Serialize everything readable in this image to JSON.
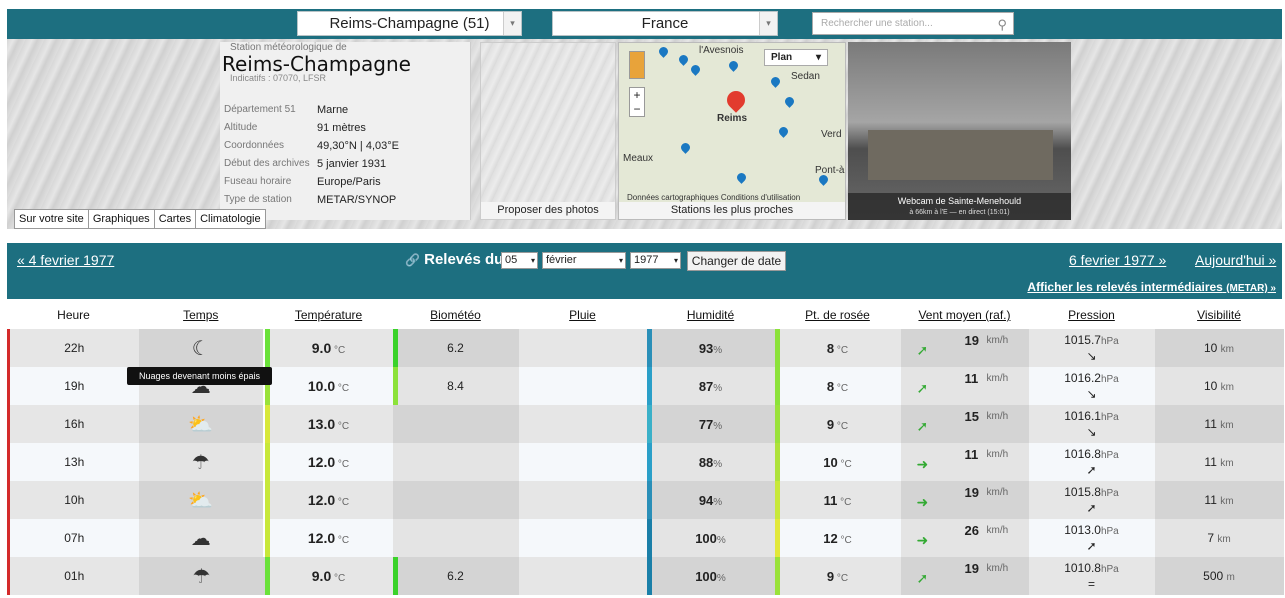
{
  "top": {
    "station_select": "Reims-Champagne (51)",
    "country_select": "France",
    "search_placeholder": "Rechercher une station..."
  },
  "station": {
    "kind": "Station météorologique de",
    "name": "Reims-Champagne",
    "indicatifs": "Indicatifs : 07070, LFSR",
    "rows": [
      {
        "k": "Département 51",
        "v": "Marne"
      },
      {
        "k": "Altitude",
        "v": "91 mètres"
      },
      {
        "k": "Coordonnées",
        "v": "49,30°N | 4,03°E"
      },
      {
        "k": "Début des archives",
        "v": "5 janvier 1931"
      },
      {
        "k": "Fuseau horaire",
        "v": "Europe/Paris"
      },
      {
        "k": "Type de station",
        "v": "METAR/SYNOP"
      }
    ]
  },
  "tabs": [
    "Sur votre site",
    "Graphiques",
    "Cartes",
    "Climatologie"
  ],
  "photos_label": "Proposer des photos",
  "map": {
    "label": "Stations les plus proches",
    "plan": "Plan",
    "attribution": "Données cartographiques   Conditions d'utilisation",
    "cities": [
      "l'Avesnois",
      "Sedan",
      "Reims",
      "Meaux",
      "Pont-à",
      "Verd"
    ]
  },
  "webcam": {
    "title": "Webcam de Sainte-Menehould",
    "sub": "à 66km à l'E — en direct (15:01)"
  },
  "datebar": {
    "prev": "« 4 fevrier 1977",
    "label": "Relevés du",
    "day": "05",
    "month": "février",
    "year": "1977",
    "change": "Changer de date",
    "next": "6 fevrier 1977 »",
    "today": "Aujourd'hui »",
    "intermediate": "Afficher les relevés intermédiaires",
    "intermediate_tag": "(METAR) »"
  },
  "columns": [
    "Heure",
    "Temps",
    "Température",
    "Biométéo",
    "Pluie",
    "Humidité",
    "Pt. de rosée",
    "Vent moyen (raf.)",
    "Pression",
    "Visibilité"
  ],
  "tooltip": "Nuages devenant moins épais",
  "rows": [
    {
      "hour": "22h",
      "icon": "clear-night-icon",
      "glyph": "☾",
      "temp": "9.0",
      "bio": "6.2",
      "hum": "93",
      "dew": "8",
      "wind": "19",
      "wind_dir": "➚",
      "press": "1015.7",
      "ptrend": "↘",
      "vis": "10",
      "vis_unit": "km",
      "tcolor": "#6ae23a",
      "bcolor": "#3ad22a",
      "hcolor": "#2a8fb8",
      "dcolor": "#8ce23a"
    },
    {
      "hour": "19h",
      "icon": "cloudy-icon",
      "glyph": "☁",
      "temp": "10.0",
      "bio": "8.4",
      "hum": "87",
      "dew": "8",
      "wind": "11",
      "wind_dir": "➚",
      "press": "1016.2",
      "ptrend": "↘",
      "vis": "10",
      "vis_unit": "km",
      "tcolor": "#9ae23a",
      "bcolor": "#8ce23a",
      "hcolor": "#2a9fc8",
      "dcolor": "#8ce23a"
    },
    {
      "hour": "16h",
      "icon": "partly-cloudy-icon",
      "glyph": "⛅",
      "temp": "13.0",
      "bio": "",
      "hum": "77",
      "dew": "9",
      "wind": "15",
      "wind_dir": "➚",
      "press": "1016.1",
      "ptrend": "↘",
      "vis": "11",
      "vis_unit": "km",
      "tcolor": "#d8e83a",
      "bcolor": "",
      "hcolor": "#3ab0c8",
      "dcolor": "#9ae23a"
    },
    {
      "hour": "13h",
      "icon": "rain-icon",
      "glyph": "☂",
      "temp": "12.0",
      "bio": "",
      "hum": "88",
      "dew": "10",
      "wind": "11",
      "wind_dir": "➜",
      "press": "1016.8",
      "ptrend": "➚",
      "vis": "11",
      "vis_unit": "km",
      "tcolor": "#c8e83a",
      "bcolor": "",
      "hcolor": "#2a9fc8",
      "dcolor": "#aee23a"
    },
    {
      "hour": "10h",
      "icon": "partly-cloudy-icon",
      "glyph": "⛅",
      "temp": "12.0",
      "bio": "",
      "hum": "94",
      "dew": "11",
      "wind": "19",
      "wind_dir": "➜",
      "press": "1015.8",
      "ptrend": "➚",
      "vis": "11",
      "vis_unit": "km",
      "tcolor": "#c8e83a",
      "bcolor": "",
      "hcolor": "#2a8fb8",
      "dcolor": "#c8e83a"
    },
    {
      "hour": "07h",
      "icon": "drizzle-icon",
      "glyph": "☁",
      "temp": "12.0",
      "bio": "",
      "hum": "100",
      "dew": "12",
      "wind": "26",
      "wind_dir": "➜",
      "press": "1013.0",
      "ptrend": "➚",
      "vis": "7",
      "vis_unit": "km",
      "tcolor": "#c8e83a",
      "bcolor": "",
      "hcolor": "#1a7fa8",
      "dcolor": "#e2e83a"
    },
    {
      "hour": "01h",
      "icon": "rain-icon",
      "glyph": "☂",
      "temp": "9.0",
      "bio": "6.2",
      "hum": "100",
      "dew": "9",
      "wind": "19",
      "wind_dir": "➚",
      "press": "1010.8",
      "ptrend": "=",
      "vis": "500",
      "vis_unit": "m",
      "tcolor": "#6ae23a",
      "bcolor": "#3ad22a",
      "hcolor": "#1a7fa8",
      "dcolor": "#9ae23a"
    }
  ]
}
